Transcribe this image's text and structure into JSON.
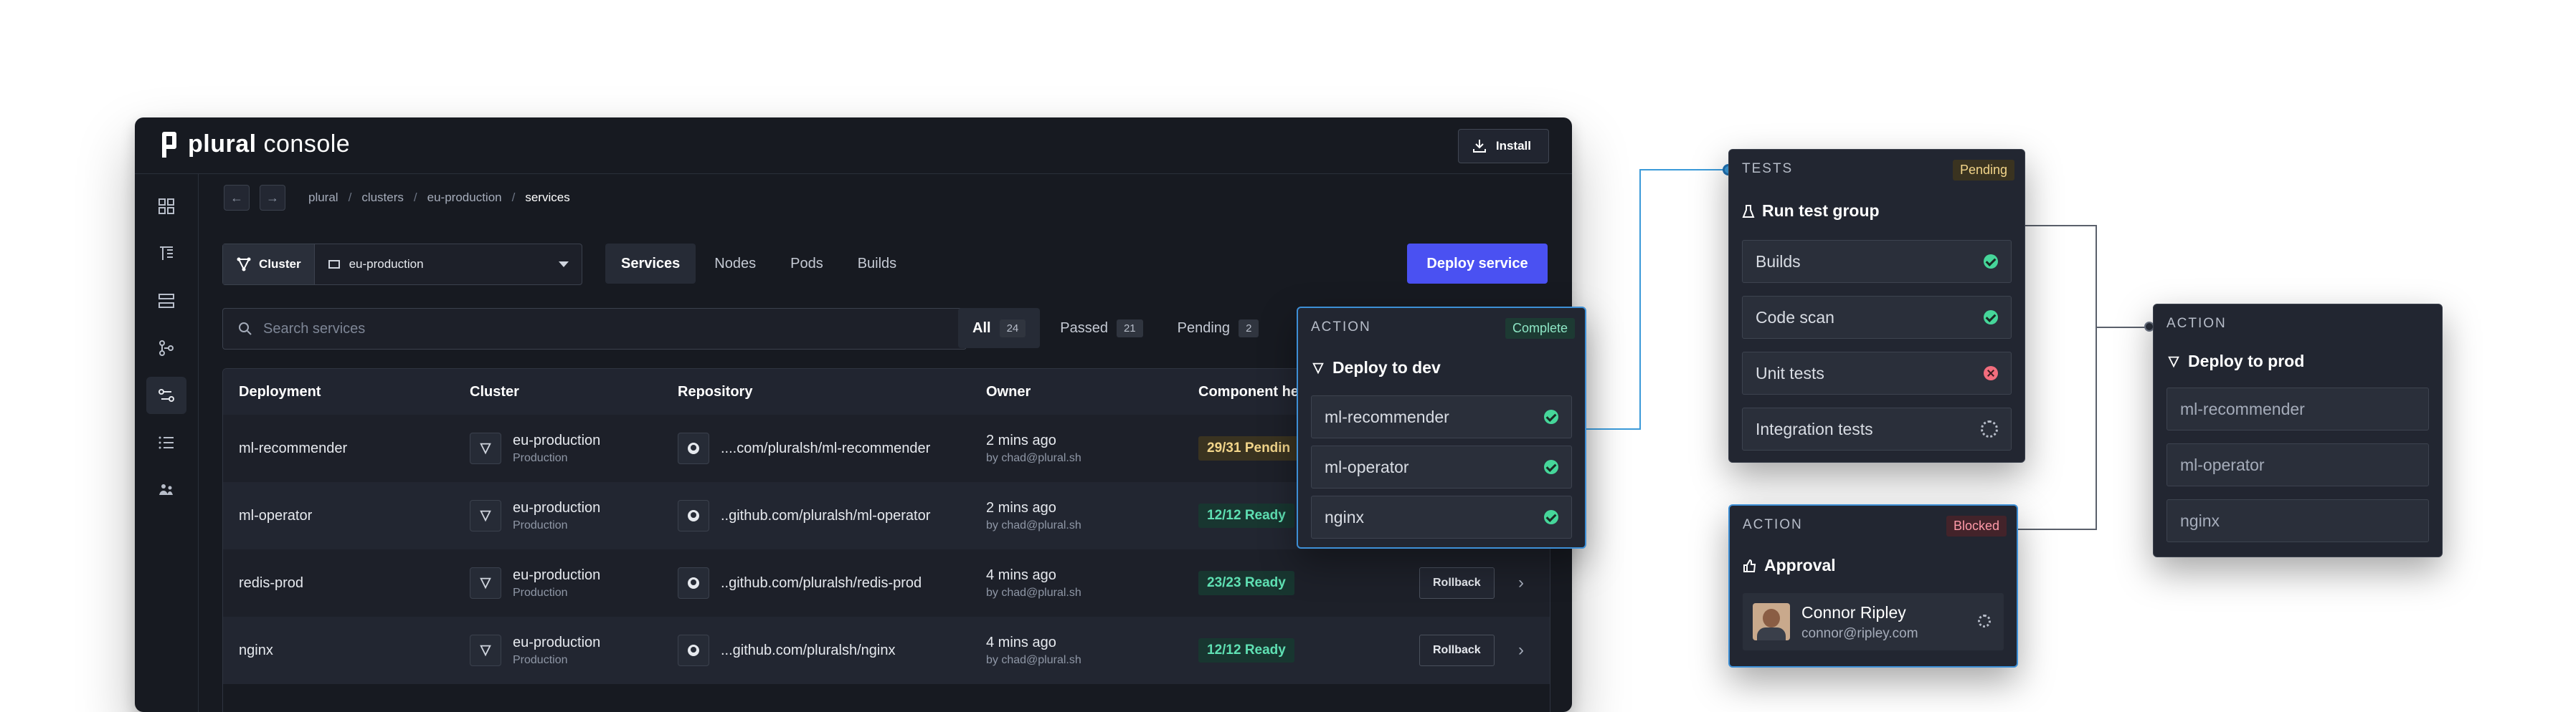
{
  "brand": {
    "name_bold": "plural",
    "name_rest": " console"
  },
  "header": {
    "install_label": "Install"
  },
  "breadcrumb": [
    "plural",
    "clusters",
    "eu-production",
    "services"
  ],
  "cluster_select": {
    "label": "Cluster",
    "value": "eu-production"
  },
  "tabs": [
    "Services",
    "Nodes",
    "Pods",
    "Builds"
  ],
  "deploy_button": "Deploy service",
  "search": {
    "placeholder": "Search services"
  },
  "filters": [
    {
      "label": "All",
      "count": "24"
    },
    {
      "label": "Passed",
      "count": "21"
    },
    {
      "label": "Pending",
      "count": "2"
    }
  ],
  "table": {
    "columns": [
      "Deployment",
      "Cluster",
      "Repository",
      "Owner",
      "Component he"
    ],
    "rows": [
      {
        "deployment": "ml-recommender",
        "cluster": "eu-production",
        "env": "Production",
        "repo": "....com/pluralsh/ml-recommender",
        "owner_time": "2 mins ago",
        "owner_by": "by chad@plural.sh",
        "health": "29/31 Pendin"
      },
      {
        "deployment": "ml-operator",
        "cluster": "eu-production",
        "env": "Production",
        "repo": "..github.com/pluralsh/ml-operator",
        "owner_time": "2 mins ago",
        "owner_by": "by chad@plural.sh",
        "health": "12/12 Ready"
      },
      {
        "deployment": "redis-prod",
        "cluster": "eu-production",
        "env": "Production",
        "repo": "..github.com/pluralsh/redis-prod",
        "owner_time": "4 mins ago",
        "owner_by": "by chad@plural.sh",
        "health": "23/23 Ready",
        "action": "Rollback"
      },
      {
        "deployment": "nginx",
        "cluster": "eu-production",
        "env": "Production",
        "repo": "...github.com/pluralsh/nginx",
        "owner_time": "4 mins ago",
        "owner_by": "by chad@plural.sh",
        "health": "12/12 Ready",
        "action": "Rollback"
      }
    ]
  },
  "deploy_dev_card": {
    "kicker": "ACTION",
    "status": "Complete",
    "title": "Deploy to dev",
    "items": [
      "ml-recommender",
      "ml-operator",
      "nginx"
    ]
  },
  "tests_card": {
    "kicker": "TESTS",
    "status": "Pending",
    "title": "Run test group",
    "items": [
      "Builds",
      "Code scan",
      "Unit tests",
      "Integration tests"
    ]
  },
  "approval_card": {
    "kicker": "ACTION",
    "status": "Blocked",
    "title": "Approval",
    "user_name": "Connor Ripley",
    "user_email": "connor@ripley.com"
  },
  "deploy_prod_card": {
    "kicker": "ACTION",
    "title": "Deploy to prod",
    "items": [
      "ml-recommender",
      "ml-operator",
      "nginx"
    ]
  },
  "colors": {
    "accent": "#4a51f2",
    "success": "#46d69a",
    "error": "#f26d7d",
    "connector": "#3b9ad9"
  }
}
